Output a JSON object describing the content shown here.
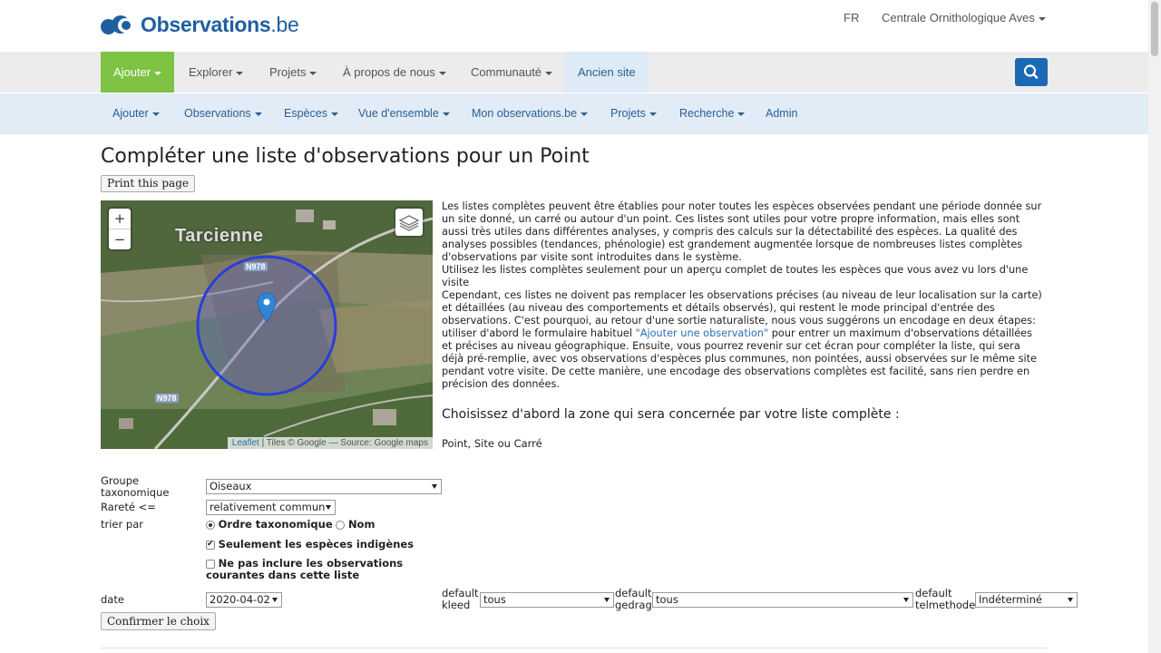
{
  "header": {
    "logo_text": "Observations",
    "logo_suffix": ".be",
    "lang": "FR",
    "org": "Centrale Ornithologique Aves"
  },
  "mainnav": {
    "items": [
      "Ajouter",
      "Explorer",
      "Projets",
      "À propos de nous",
      "Communauté",
      "Ancien site"
    ]
  },
  "subnav": {
    "items": [
      "Ajouter",
      "Observations",
      "Espèces",
      "Vue d'ensemble",
      "Mon observations.be",
      "Projets",
      "Recherche",
      "Admin"
    ]
  },
  "page": {
    "title": "Compléter une liste d'observations pour un Point",
    "print_button": "Print this page"
  },
  "map": {
    "zoom_in": "+",
    "zoom_out": "−",
    "town": "Tarcienne",
    "road1": "N978",
    "road2": "N978",
    "attribution_link": "Leaflet",
    "attribution_rest": " | Tiles © Google — Source: Google maps"
  },
  "intro": {
    "p1": "Les listes complètes peuvent être établies pour noter toutes les espèces observées pendant une période donnée sur un site donné, un carré ou autour d'un point. Ces listes sont utiles pour votre propre information, mais elles sont aussi très utiles dans différentes analyses, y compris des calculs sur la détectabilité des espèces. La qualité des analyses possibles (tendances, phénologie) est grandement augmentée lorsque de nombreuses listes complètes d'observations par visite sont introduites dans le système.",
    "p2": "Utilisez les listes complètes seulement pour un aperçu complet de toutes les espèces que vous avez vu lors d'une visite",
    "p3a": "Cependant, ces listes ne doivent pas remplacer les observations précises (au niveau de leur localisation sur la carte) et détaillées (au niveau des comportements et détails observés), qui restent le mode principal d'entrée des observations. C'est pourquoi, au retour d'une sortie naturaliste, nous vous suggérons un encodage en deux étapes: utiliser d'abord le formulaire habituel ",
    "p3_link": "\"Ajouter une observation\"",
    "p3b": " pour entrer un maximum d'observations détaillées et précises au niveau géographique. Ensuite, vous pourrez revenir sur cet écran pour compléter la liste, qui sera déjà pré-remplie, avec vos observations d'espèces plus communes, non pointées, aussi observées sur le même site pendant votre visite. De cette manière, une encodage des observations complètes est facilité, sans rien perdre en précision des données.",
    "zone_heading": "Choisissez d'abord la zone qui sera concernée par votre liste complète :",
    "zone_choice": "Point, Site ou Carré"
  },
  "form": {
    "groupe_label": "Groupe taxonomique",
    "groupe_value": "Oiseaux",
    "rarete_label": "Rareté <=",
    "rarete_value": "relativement commun",
    "trier_label": "trier par",
    "sort_option1": "Ordre taxonomique",
    "sort_option2": "Nom",
    "indigenous_label": "Seulement les espèces indigènes",
    "exclude_label": "Ne pas inclure les observations courantes dans cette liste",
    "date_label": "date",
    "date_value": "2020-04-02",
    "kleed_label": "default kleed",
    "kleed_value": "tous",
    "gedrag_label": "default gedrag",
    "gedrag_value": "tous",
    "telmethode_label": "default telmethode",
    "telmethode_value": "Indéterminé",
    "confirm_button": "Confirmer le choix"
  },
  "colors": {
    "brand_blue": "#1f5fa0",
    "active_green": "#7dc243",
    "subnav_bg": "#e1ecf7",
    "search_btn": "#1a6ab3"
  }
}
